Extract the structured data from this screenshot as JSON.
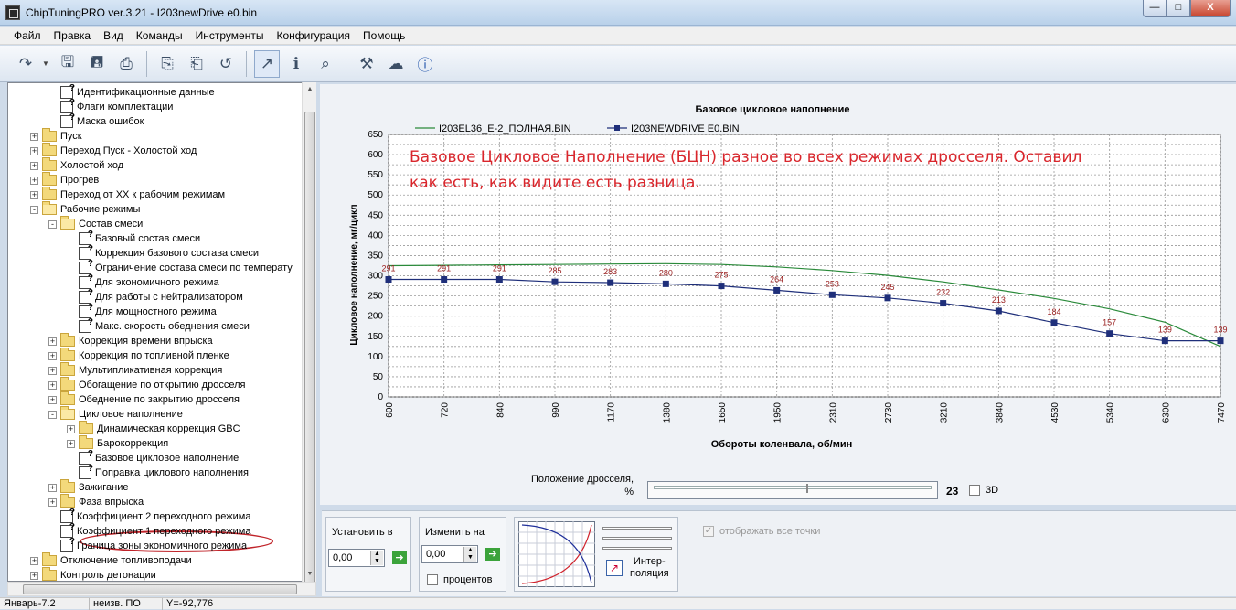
{
  "window": {
    "title": "ChipTuningPRO ver.3.21 - I203newDrive e0.bin",
    "buttons": {
      "minimize": "—",
      "maximize": "□",
      "close": "X"
    }
  },
  "menu": [
    "Файл",
    "Правка",
    "Вид",
    "Команды",
    "Инструменты",
    "Конфигурация",
    "Помощь"
  ],
  "toolbar": {
    "icons": [
      "open-icon",
      "save-icon",
      "save-as-icon",
      "print-icon",
      "copy-icon",
      "paste-icon",
      "undo-icon",
      "chart-view-icon",
      "info-icon",
      "search-icon",
      "settings-icon",
      "network-icon",
      "help-icon"
    ]
  },
  "tree": {
    "items": [
      {
        "label": "Идентификационные данные",
        "icon": "doc",
        "expander": "none"
      },
      {
        "label": "Флаги комплектации",
        "icon": "doc",
        "expander": "none"
      },
      {
        "label": "Маска ошибок",
        "icon": "doc",
        "expander": "none"
      },
      {
        "label": "Пуск",
        "icon": "folder",
        "expander": "+"
      },
      {
        "label": "Переход Пуск - Холостой ход",
        "icon": "folder",
        "expander": "+"
      },
      {
        "label": "Холостой ход",
        "icon": "folder",
        "expander": "+"
      },
      {
        "label": "Прогрев",
        "icon": "folder",
        "expander": "+"
      },
      {
        "label": "Переход от ХХ к рабочим режимам",
        "icon": "folder",
        "expander": "+"
      },
      {
        "label": "Рабочие режимы",
        "icon": "folder-open",
        "expander": "-"
      },
      {
        "label": "Состав смеси",
        "icon": "folder-open",
        "expander": "-"
      },
      {
        "label": "Базовый состав смеси",
        "icon": "doc",
        "expander": "none"
      },
      {
        "label": "Коррекция базового состава смеси",
        "icon": "doc",
        "expander": "none"
      },
      {
        "label": "Ограничение состава смеси по температу",
        "icon": "doc",
        "expander": "none"
      },
      {
        "label": "Для экономичного режима",
        "icon": "doc",
        "expander": "none"
      },
      {
        "label": "Для работы с нейтрализатором",
        "icon": "doc",
        "expander": "none"
      },
      {
        "label": "Для мощностного режима",
        "icon": "doc",
        "expander": "none"
      },
      {
        "label": "Макс. скорость обеднения смеси",
        "icon": "doc",
        "expander": "none"
      },
      {
        "label": "Коррекция времени впрыска",
        "icon": "folder",
        "expander": "+"
      },
      {
        "label": "Коррекция по топливной пленке",
        "icon": "folder",
        "expander": "+"
      },
      {
        "label": "Мультипликативная коррекция",
        "icon": "folder",
        "expander": "+"
      },
      {
        "label": "Обогащение по открытию дросселя",
        "icon": "folder",
        "expander": "+"
      },
      {
        "label": "Обеднение по закрытию дросселя",
        "icon": "folder",
        "expander": "+"
      },
      {
        "label": "Цикловое наполнение",
        "icon": "folder-open",
        "expander": "-"
      },
      {
        "label": "Динамическая коррекция GBC",
        "icon": "folder",
        "expander": "+"
      },
      {
        "label": "Барокоррекция",
        "icon": "folder",
        "expander": "+"
      },
      {
        "label": "Базовое цикловое наполнение",
        "icon": "doc",
        "expander": "none"
      },
      {
        "label": "Поправка циклового наполнения",
        "icon": "doc",
        "expander": "none"
      },
      {
        "label": "Зажигание",
        "icon": "folder",
        "expander": "+"
      },
      {
        "label": "Фаза впрыска",
        "icon": "folder",
        "expander": "+"
      },
      {
        "label": "Коэффициент 2 переходного режима",
        "icon": "doc",
        "expander": "none"
      },
      {
        "label": "Коэффициент 1 переходного режима",
        "icon": "doc",
        "expander": "none"
      },
      {
        "label": "Граница зоны экономичного режима",
        "icon": "doc",
        "expander": "none"
      },
      {
        "label": "Отключение топливоподачи",
        "icon": "folder",
        "expander": "+"
      },
      {
        "label": "Контроль детонации",
        "icon": "folder",
        "expander": "+"
      }
    ],
    "selected": "Базовое цикловое наполнение"
  },
  "chart_data": {
    "type": "line",
    "title": "Базовое цикловое наполнение",
    "xlabel": "Обороты коленвала, об/мин",
    "ylabel": "Цикловое наполнение, мг/цикл",
    "categories": [
      "600",
      "720",
      "840",
      "990",
      "1170",
      "1380",
      "1650",
      "1950",
      "2310",
      "2730",
      "3210",
      "3840",
      "4530",
      "5340",
      "6300",
      "7470"
    ],
    "ylim": [
      0,
      650
    ],
    "yticks": [
      0,
      25,
      50,
      75,
      100,
      125,
      150,
      175,
      200,
      225,
      250,
      275,
      300,
      325,
      350,
      375,
      400,
      425,
      450,
      475,
      500,
      525,
      550,
      575,
      600,
      625,
      650
    ],
    "ytick_labels_shown": [
      0,
      50,
      100,
      150,
      200,
      250,
      300,
      350,
      400,
      450,
      500,
      550,
      600,
      650
    ],
    "grid": true,
    "legend_position": "top-left",
    "series": [
      {
        "name": "I203EL36_E-2_ПОЛНАЯ.BIN",
        "color": "#2a8a3a",
        "marker": "none",
        "values": [
          325,
          326,
          327,
          328,
          329,
          330,
          328,
          322,
          313,
          301,
          285,
          265,
          244,
          218,
          185,
          125
        ]
      },
      {
        "name": "I203NEWDRIVE E0.BIN",
        "color": "#1f2f7a",
        "marker": "square",
        "values": [
          291,
          291,
          291,
          285,
          283,
          280,
          275,
          264,
          253,
          245,
          232,
          213,
          184,
          157,
          139,
          139
        ],
        "data_labels": [
          "291",
          "291",
          "291",
          "285",
          "283",
          "280",
          "275",
          "264",
          "253",
          "245",
          "232",
          "213",
          "184",
          "157",
          "139",
          "139"
        ]
      }
    ],
    "annotation": {
      "text_line1": "Базовое Цикловое Наполнение (БЦН) разное во всех режимах дросселя. Оставил",
      "text_line2": "как есть, как видите есть разница.",
      "color": "#d9262c"
    }
  },
  "throttle": {
    "label_line1": "Положение дросселя,",
    "label_line2": "%",
    "value": "23",
    "position_percent": 55,
    "checkbox_3d_label": "3D"
  },
  "controls": {
    "set_label": "Установить в",
    "set_value": "0,00",
    "change_label": "Изменить на",
    "change_value": "0,00",
    "percent_label": "процентов",
    "interp_label_line1": "Интер-",
    "interp_label_line2": "поляция",
    "show_all_points_label": "отображать все точки"
  },
  "status": {
    "cell1": "Январь-7.2",
    "cell2": "неизв. ПО",
    "cell3": "Y=-92,776"
  }
}
